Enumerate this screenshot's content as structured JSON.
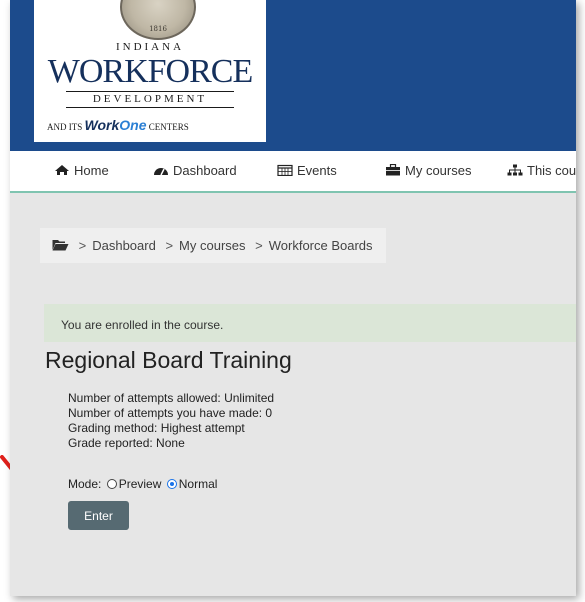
{
  "logo": {
    "seal_year": "1816",
    "line1": "INDIANA",
    "line2": "WORKFORCE",
    "line3": "DEVELOPMENT",
    "tag_prefix": "AND ITS",
    "tag_work": "Work",
    "tag_one": "One",
    "tag_suffix": "CENTERS"
  },
  "nav": {
    "home": "Home",
    "dashboard": "Dashboard",
    "events": "Events",
    "my_courses": "My courses",
    "this_course": "This cour"
  },
  "breadcrumb": {
    "items": [
      "Dashboard",
      "My courses",
      "Workforce Boards"
    ],
    "separator": ">"
  },
  "alert": {
    "text": "You are enrolled in the course."
  },
  "page": {
    "title": "Regional Board Training",
    "info": [
      "Number of attempts allowed: Unlimited",
      "Number of attempts you have made: 0",
      "Grading method: Highest attempt",
      "Grade reported: None"
    ],
    "mode_label": "Mode:",
    "mode_options": [
      "Preview",
      "Normal"
    ],
    "mode_selected": "Normal",
    "enter_label": "Enter"
  },
  "colors": {
    "banner": "#1c4b8c",
    "nav_underline": "#7fc4b0",
    "alert_bg": "#dbe6d7",
    "button_bg": "#566a72",
    "annotation_arrow": "#e0201b"
  },
  "icons": {
    "home": "home-icon",
    "dashboard": "dashboard-gauge-icon",
    "events": "calendar-icon",
    "my_courses": "briefcase-icon",
    "this_course": "sitemap-icon",
    "breadcrumb": "folder-open-icon"
  }
}
